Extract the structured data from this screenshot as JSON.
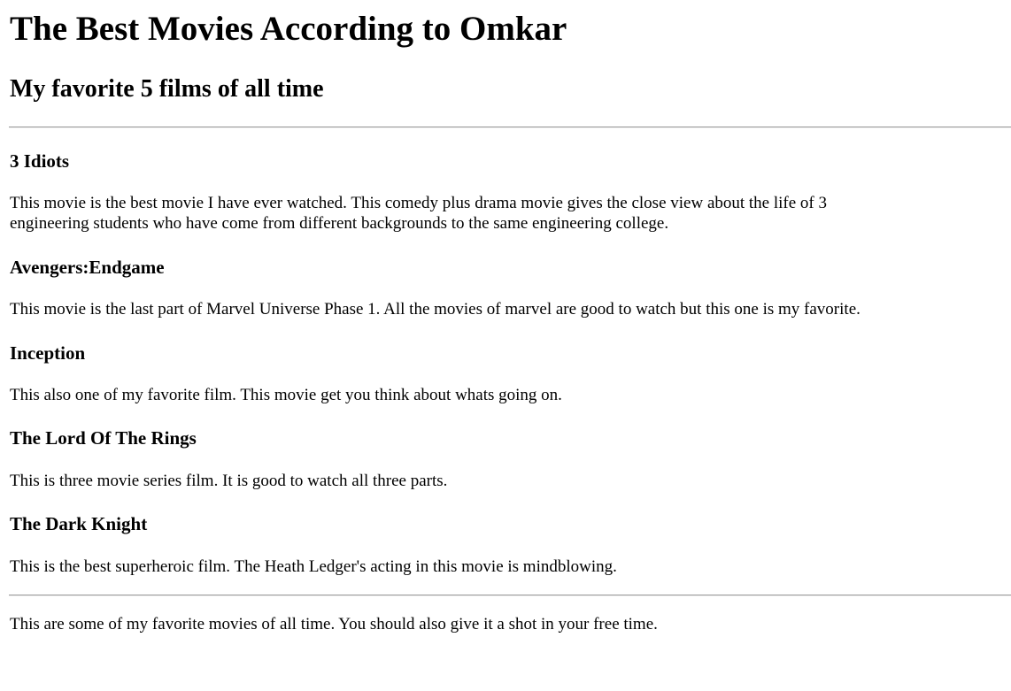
{
  "page": {
    "title": "The Best Movies According to Omkar",
    "subtitle": "My favorite 5 films of all time"
  },
  "movies": [
    {
      "title": "3 Idiots",
      "description": "This movie is the best movie I have ever watched. This comedy plus drama movie gives the close view about the life of 3 engineering students who have come from different backgrounds to the same engineering college."
    },
    {
      "title": "Avengers:Endgame",
      "description": "This movie is the last part of Marvel Universe Phase 1. All the movies of marvel are good to watch but this one is my favorite."
    },
    {
      "title": "Inception",
      "description": "This also one of my favorite film. This movie get you think about whats going on."
    },
    {
      "title": "The Lord Of The Rings",
      "description": "This is three movie series film. It is good to watch all three parts."
    },
    {
      "title": "The Dark Knight",
      "description": "This is the best superheroic film. The Heath Ledger's acting in this movie is mindblowing."
    }
  ],
  "footer": {
    "text": "This are some of my favorite movies of all time. You should also give it a shot in your free time."
  }
}
